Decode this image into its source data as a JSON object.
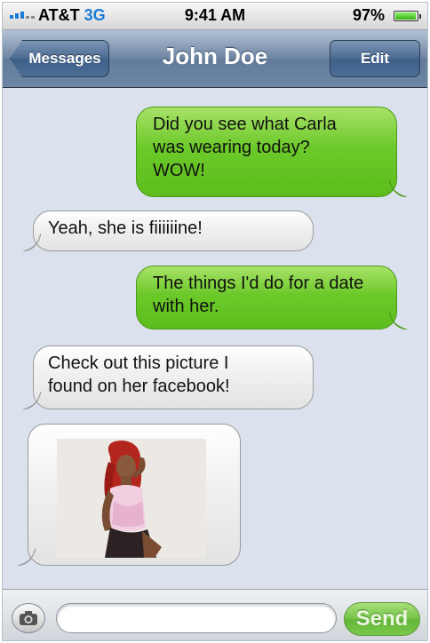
{
  "status_bar": {
    "carrier": "AT&T",
    "network": "3G",
    "time": "9:41 AM",
    "battery_percent": "97%",
    "battery_level": 0.97,
    "signal_icon": "signal-bars-icon"
  },
  "nav_bar": {
    "back_label": "Messages",
    "title": "John Doe",
    "edit_label": "Edit"
  },
  "messages": [
    {
      "direction": "sent",
      "text": "Did you see what Carla\nwas wearing today?\nWOW!"
    },
    {
      "direction": "received",
      "text": "Yeah, she is fiiiiiine!"
    },
    {
      "direction": "sent",
      "text": "The things I'd do for a date\nwith her."
    },
    {
      "direction": "received",
      "text": "Check out this picture I\nfound on her facebook!"
    },
    {
      "direction": "received",
      "type": "photo"
    }
  ],
  "input_bar": {
    "camera_icon": "camera-icon",
    "placeholder": "",
    "send_label": "Send"
  },
  "colors": {
    "sent_bubble": "#6cc92a",
    "received_bubble": "#efefef",
    "nav_bar": "#6d84a2",
    "background": "#dbe2ed",
    "network_accent": "#1a7bd6"
  }
}
